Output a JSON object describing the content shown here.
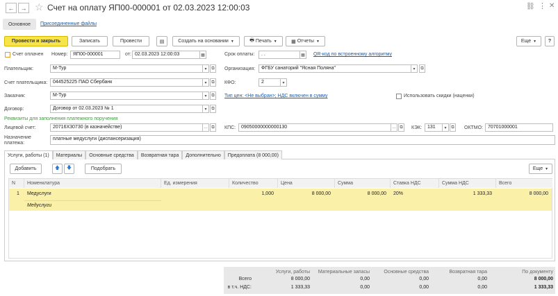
{
  "window": {
    "title": "Счет на оплату ЯП00-000001 от 02.03.2023 12:00:03"
  },
  "nav_tabs": {
    "main": "Основное",
    "files": "Присоединенные файлы"
  },
  "toolbar": {
    "post_close": "Провести и закрыть",
    "save": "Записать",
    "post": "Провести",
    "create_based": "Создать на основании",
    "print": "Печать",
    "reports": "Отчеты",
    "more": "Еще"
  },
  "header": {
    "paid_label": "Счет оплачен",
    "number_label": "Номер:",
    "number_value": "ЯП00-000001",
    "from_label": "от:",
    "date_value": "02.03.2023 12:00:03",
    "due_label": "Срок оплаты:",
    "due_value": ". .",
    "qr_link": "QR-код по встроенному алгоритму",
    "payer_label": "Плательщик:",
    "payer_value": "М-Тур",
    "org_label": "Организация:",
    "org_value": "ФГБУ санаторий \"Ясная Поляна\"",
    "payer_acc_label": "Счет плательщика:",
    "payer_acc_value": "044525225 ПАО Сбербанк",
    "kfo_label": "КФО:",
    "kfo_value": "2",
    "customer_label": "Заказчик:",
    "customer_value": "М-Тур",
    "price_link": "Тип цен: <Не выбран>; НДС включен в сумму",
    "discount_label": "Использовать скидки (наценки)",
    "contract_label": "Договор:",
    "contract_value": "Договор от 02.03.2023 № 1",
    "requisites_title": "Реквизиты для заполнения платежного поручения",
    "personal_acc_label": "Лицевой счет:",
    "personal_acc_value": "20716Х30730 (в казначействе)",
    "kps_label": "КПС:",
    "kps_value": "09050000000000130",
    "kek_label": "КЭК:",
    "kek_value": "131",
    "oktmo_label": "ОКТМО:",
    "oktmo_value": "70701000001",
    "purpose_label": "Назначение платежа:",
    "purpose_value": "платные медуслуги (диспансеризация)"
  },
  "tabs": [
    "Услуги, работы (1)",
    "Материалы",
    "Основные средства",
    "Возвратная тара",
    "Дополнительно",
    "Предоплата (8 000,00)"
  ],
  "table_toolbar": {
    "add": "Добавить",
    "up_icon": "arrow-up-icon",
    "down_icon": "arrow-down-icon",
    "select": "Подобрать",
    "more": "Еще"
  },
  "columns": [
    "N",
    "Номенклатура",
    "Ед. измерения",
    "Количество",
    "Цена",
    "Сумма",
    "Ставка НДС",
    "Сумма НДС",
    "Всего"
  ],
  "rows": [
    {
      "n": "1",
      "nomenclature": "Медуслуги",
      "sub": "Медуслуги",
      "unit": "",
      "qty": "1,000",
      "price": "8 000,00",
      "sum": "8 000,00",
      "vat_rate": "20%",
      "vat_sum": "1 333,33",
      "total": "8 000,00"
    }
  ],
  "footer": {
    "headers": [
      "Услуги, работы",
      "Материальные запасы",
      "Основные средства",
      "Возвратная тара",
      "По документу"
    ],
    "total_label": "Всего",
    "total_values": [
      "8 000,00",
      "0,00",
      "0,00",
      "0,00",
      "8 000,00"
    ],
    "vat_label": "в т.ч. НДС:",
    "vat_values": [
      "1 333,33",
      "0,00",
      "0,00",
      "0,00",
      "1 333,33"
    ]
  },
  "colors": {
    "accent_yellow": "#f7e34a",
    "row_highlight": "#fbf0a8",
    "link": "#1a5cab",
    "green": "#3c9b3c"
  }
}
